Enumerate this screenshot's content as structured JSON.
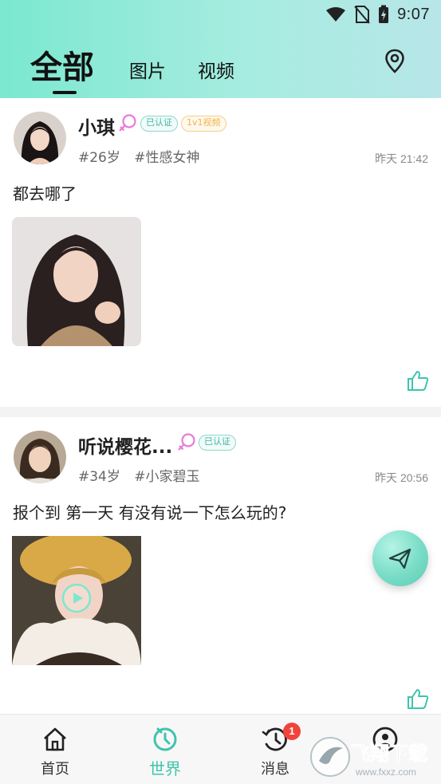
{
  "status_bar": {
    "time": "9:07"
  },
  "header": {
    "tabs": [
      {
        "label": "全部",
        "active": true
      },
      {
        "label": "图片",
        "active": false
      },
      {
        "label": "视频",
        "active": false
      }
    ],
    "location_icon": "location-pin-icon"
  },
  "posts": [
    {
      "name": "小琪",
      "gender_icon": "female-icon",
      "badges": [
        "已认证",
        "1v1视频"
      ],
      "tags": [
        "#26岁",
        "#性感女神"
      ],
      "time": "昨天 21:42",
      "content": "都去哪了",
      "media": "photo",
      "like_icon": "thumbs-up-icon"
    },
    {
      "name": "听说樱花...",
      "gender_icon": "female-icon",
      "badges": [
        "已认证"
      ],
      "tags": [
        "#34岁",
        "#小家碧玉"
      ],
      "time": "昨天 20:56",
      "content": "报个到 第一天 有没有说一下怎么玩的?",
      "media": "video",
      "like_icon": "thumbs-up-icon"
    }
  ],
  "fab": {
    "icon": "send-icon"
  },
  "bottom_nav": [
    {
      "label": "首页",
      "icon": "home-icon",
      "active": false
    },
    {
      "label": "世界",
      "icon": "world-icon",
      "active": true
    },
    {
      "label": "消息",
      "icon": "message-clock-icon",
      "active": false,
      "badge": "1"
    },
    {
      "label": "",
      "icon": "profile-icon",
      "active": false
    }
  ],
  "watermark": {
    "text": "飞翔下载",
    "url_text": "www.fxxz.com"
  },
  "colors": {
    "accent": "#3fc4ad",
    "header_start": "#7be8cf",
    "badge_red": "#f0443a"
  }
}
